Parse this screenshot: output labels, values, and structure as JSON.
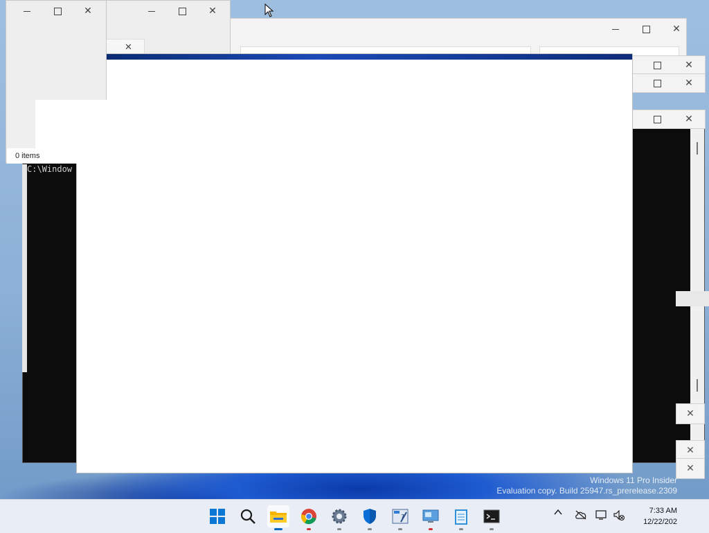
{
  "explorer_small": {
    "status_text": "0 items"
  },
  "console": {
    "path_text": "C:\\Window"
  },
  "watermark": {
    "line1": "Windows 11 Pro Insider",
    "line2": "Evaluation copy. Build 25947.rs_prerelease.2309"
  },
  "taskbar": {
    "items": [
      {
        "name": "Start",
        "icon": "windows-start-icon"
      },
      {
        "name": "Search",
        "icon": "search-icon"
      },
      {
        "name": "File Explorer",
        "icon": "folder-icon",
        "running": true,
        "active": true
      },
      {
        "name": "Google Chrome",
        "icon": "chrome-icon",
        "running": true
      },
      {
        "name": "Settings",
        "icon": "gear-icon",
        "running": true
      },
      {
        "name": "Windows Security",
        "icon": "shield-icon",
        "running": true
      },
      {
        "name": "Control Panel",
        "icon": "control-panel-icon",
        "running": true
      },
      {
        "name": "Remote Desktop",
        "icon": "remote-desktop-icon",
        "running": true
      },
      {
        "name": "Notepad",
        "icon": "notepad-icon",
        "running": true
      },
      {
        "name": "Terminal",
        "icon": "terminal-icon",
        "running": true
      }
    ],
    "tray": {
      "time": "7:33 AM",
      "date": "12/22/202"
    }
  },
  "colors": {
    "accent": "#0067c0",
    "taskbar": "#e9eef6",
    "console_bg": "#0c0c0c"
  }
}
